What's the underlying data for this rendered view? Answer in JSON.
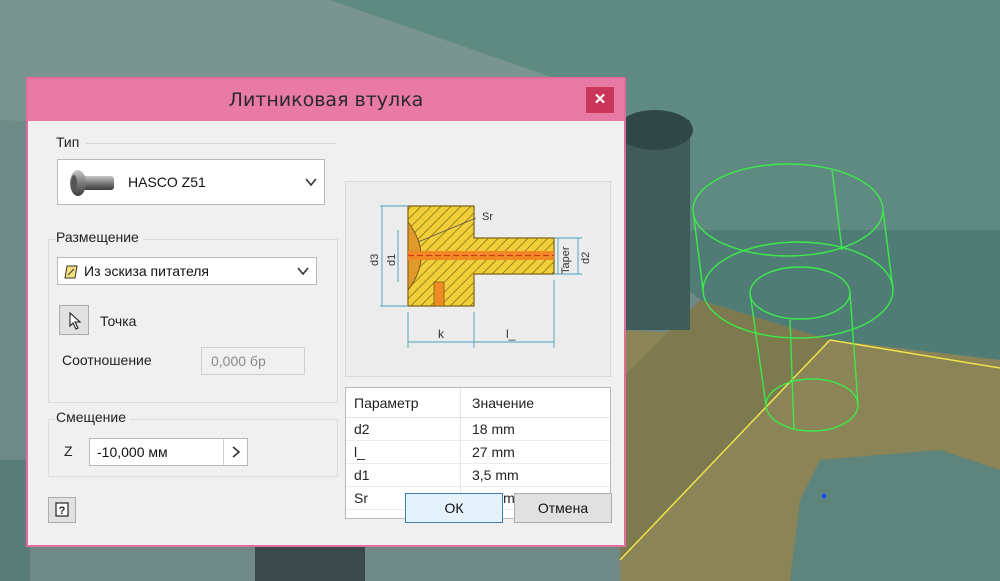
{
  "dialog": {
    "title": "Литниковая втулка",
    "close_icon": "close-icon"
  },
  "type_group": {
    "label": "Тип",
    "selected": "HASCO Z51",
    "thumbnail_icon": "bushing-thumbnail-icon"
  },
  "placement_group": {
    "label": "Размещение",
    "selected": "Из эскиза питателя",
    "sketch_icon": "sketch-icon",
    "point_label": "Точка",
    "ratio_label": "Соотношение",
    "ratio_value": "0,000 бр"
  },
  "offset_group": {
    "label": "Смещение",
    "axis_label": "Z",
    "value": "-10,000 мм"
  },
  "diagram": {
    "labels": {
      "sr": "Sr",
      "d3": "d3",
      "d1": "d1",
      "taper": "Taper",
      "d2": "d2",
      "k": "k",
      "l": "l_"
    }
  },
  "params_table": {
    "columns": [
      "Параметр",
      "Значение"
    ],
    "rows": [
      {
        "name": "d2",
        "value": "18 mm"
      },
      {
        "name": "l_",
        "value": "27 mm"
      },
      {
        "name": "d1",
        "value": "3,5 mm"
      },
      {
        "name": "Sr",
        "value": "40 mm"
      }
    ]
  },
  "buttons": {
    "ok": "ОК",
    "cancel": "Отмена",
    "help": "?"
  },
  "colors": {
    "titlebar": "#e97aa4",
    "close": "#c9365a",
    "wireframe": "#3ee84a",
    "body_yellow": "#f2cf38"
  }
}
